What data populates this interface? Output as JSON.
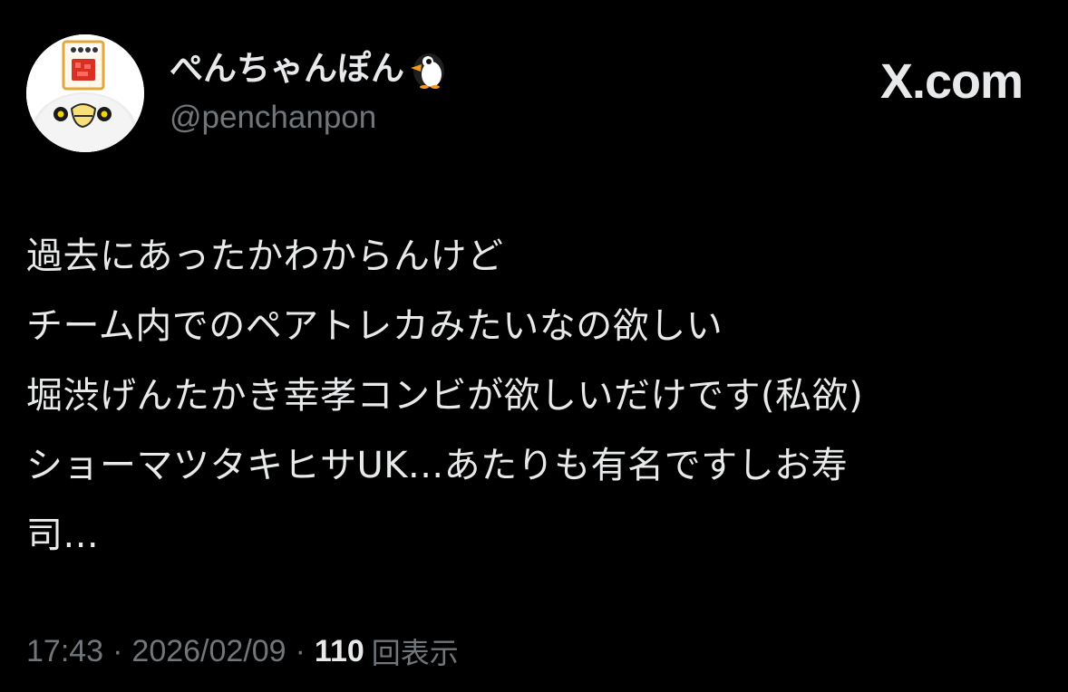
{
  "author": {
    "display_name": "ぺんちゃんぽん",
    "handle": "@penchanpon",
    "avatar_icon": "penguin-avatar-icon",
    "name_emoji": "penguin-icon"
  },
  "brand": {
    "text": "X.com"
  },
  "post": {
    "lines": [
      "過去にあったかわからんけど",
      "チーム内でのペアトレカみたいなの欲しい",
      "堀渋げんたかき幸孝コンビが欲しいだけです(私欲)",
      "ショーマツタキヒサUK...あたりも有名ですしお寿",
      "司..."
    ]
  },
  "meta": {
    "time": "17:43",
    "separator": "·",
    "date": "2026/02/09",
    "views_count": "110",
    "views_label": "回表示"
  },
  "colors": {
    "background": "#000000",
    "primary_text": "#e7e9ea",
    "secondary_text": "#71767b",
    "avatar_tag": "#d93025"
  }
}
